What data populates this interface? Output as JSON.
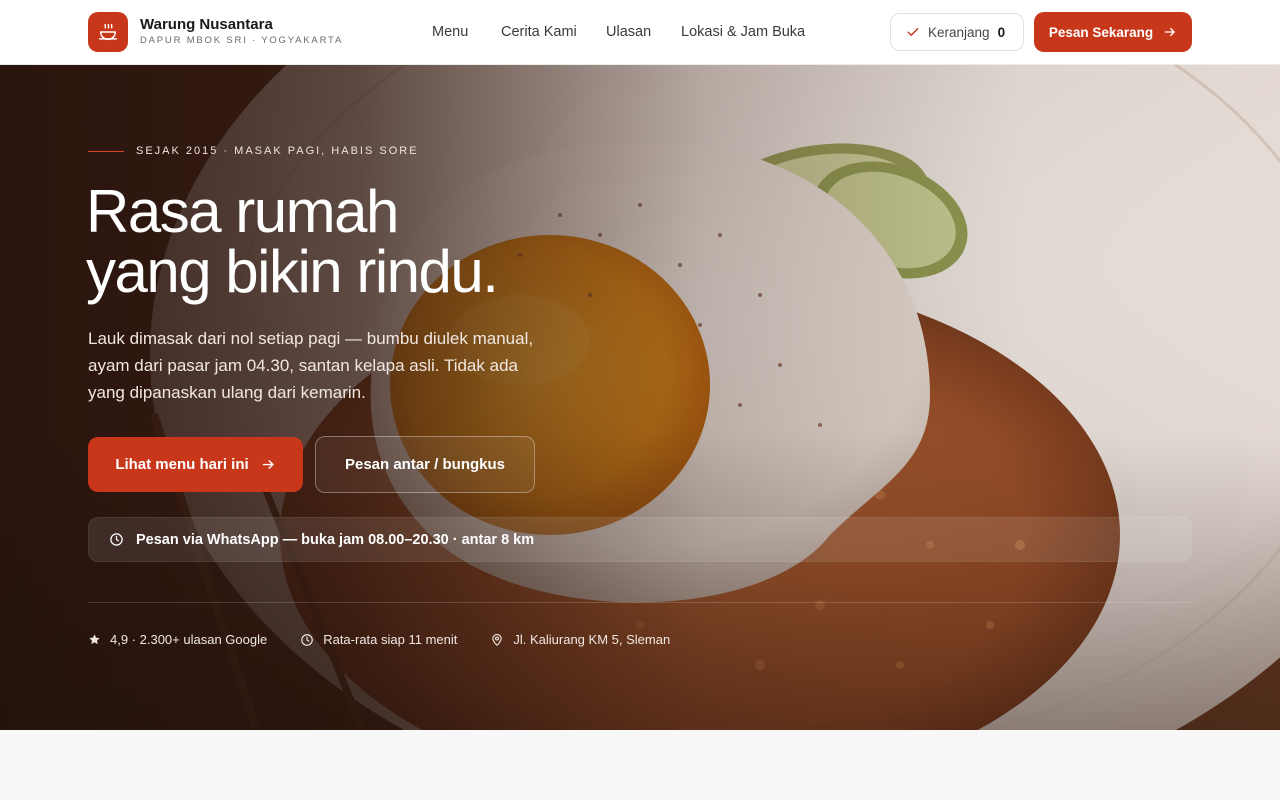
{
  "brand": {
    "name": "Warung Nusantara",
    "tagline": "DAPUR MBOK SRI · YOGYAKARTA",
    "logo_icon": "steaming-bowl-icon"
  },
  "nav": {
    "items": [
      {
        "label": "Menu"
      },
      {
        "label": "Cerita Kami"
      },
      {
        "label": "Ulasan"
      },
      {
        "label": "Lokasi & Jam Buka"
      }
    ]
  },
  "header_actions": {
    "cart_label": "Keranjang",
    "cart_count": "0",
    "order_label": "Pesan Sekarang"
  },
  "hero": {
    "eyebrow": "SEJAK 2015 · MASAK PAGI, HABIS SORE",
    "headline_line1": "Rasa rumah",
    "headline_line2": "yang bikin rindu.",
    "lede": "Lauk dimasak dari nol setiap pagi — bumbu diulek manual, ayam dari pasar jam 04.30, santan kelapa asli. Tidak ada yang dipanaskan ulang dari kemarin.",
    "cta_primary": "Lihat menu hari ini",
    "cta_secondary": "Pesan antar / bungkus",
    "whatsapp_bar": "Pesan via WhatsApp — buka jam 08.00–20.30 · antar 8 km",
    "stats": [
      {
        "icon": "star-icon",
        "text": "4,9 · 2.300+ ulasan Google"
      },
      {
        "icon": "clock-icon",
        "text": "Rata-rata siap 11 menit"
      },
      {
        "icon": "map-pin-icon",
        "text": "Jl. Kaliurang KM 5, Sleman"
      }
    ]
  },
  "colors": {
    "accent": "#c8371a",
    "header_bg": "#ffffff",
    "page_bg": "#f7f7f7",
    "hero_text": "#ffffff"
  }
}
